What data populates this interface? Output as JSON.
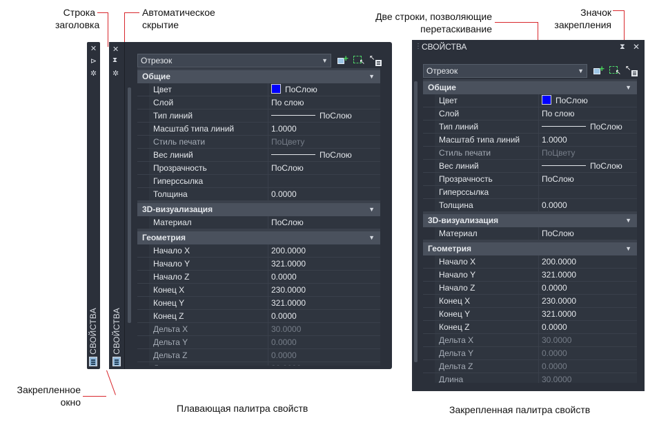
{
  "annotations": {
    "title_bar": "Строка\nзаголовка",
    "auto_hide": "Автоматическое\nскрытие",
    "drag_rows": "Две строки, позволяющие\nперетаскивание",
    "dock_icon": "Значок\nзакрепления",
    "docked_window": "Закрепленное\nокно"
  },
  "captions": {
    "floating": "Плавающая палитра свойств",
    "docked": "Закрепленная палитра свойств"
  },
  "palette": {
    "title": "СВОЙСТВА",
    "dock_title": "СВОЙСТВА",
    "object_type": "Отрезок",
    "icons": [
      "close-icon",
      "autohide-icon",
      "settings-icon",
      "quick-select-icon",
      "select-objects-icon",
      "toggle-pickadd-icon",
      "palette-icon",
      "anchor-icon"
    ],
    "sections": [
      {
        "name": "Общие",
        "rows": [
          {
            "key": "Цвет",
            "value": "ПоСлою",
            "swatch": "#0000ff"
          },
          {
            "key": "Слой",
            "value": "По слою"
          },
          {
            "key": "Тип линий",
            "value": "ПоСлою",
            "line": true
          },
          {
            "key": "Масштаб типа линий",
            "value": "1.0000"
          },
          {
            "key": "Стиль печати",
            "value": "ПоЦвету",
            "dim": true
          },
          {
            "key": "Вес линий",
            "value": "ПоСлою",
            "line": true
          },
          {
            "key": "Прозрачность",
            "value": "ПоСлою"
          },
          {
            "key": "Гиперссылка",
            "value": ""
          },
          {
            "key": "Толщина",
            "value": "0.0000"
          }
        ]
      },
      {
        "name": "3D-визуализация",
        "rows": [
          {
            "key": "Материал",
            "value": "ПоСлою"
          }
        ]
      },
      {
        "name": "Геометрия",
        "rows": [
          {
            "key": "Начало X",
            "value": "200.0000"
          },
          {
            "key": "Начало Y",
            "value": "321.0000"
          },
          {
            "key": "Начало Z",
            "value": "0.0000"
          },
          {
            "key": "Конец X",
            "value": "230.0000"
          },
          {
            "key": "Конец Y",
            "value": "321.0000"
          },
          {
            "key": "Конец Z",
            "value": "0.0000"
          },
          {
            "key": "Дельта X",
            "value": "30.0000",
            "dim": true
          },
          {
            "key": "Дельта Y",
            "value": "0.0000",
            "dim": true
          },
          {
            "key": "Дельта Z",
            "value": "0.0000",
            "dim": true
          },
          {
            "key": "Длина",
            "value": "30.0000",
            "dim": true
          }
        ]
      }
    ]
  },
  "colors": {
    "callout": "#d8262b",
    "panel_bg": "#2b303a",
    "color_swatch": "#0000ff"
  }
}
